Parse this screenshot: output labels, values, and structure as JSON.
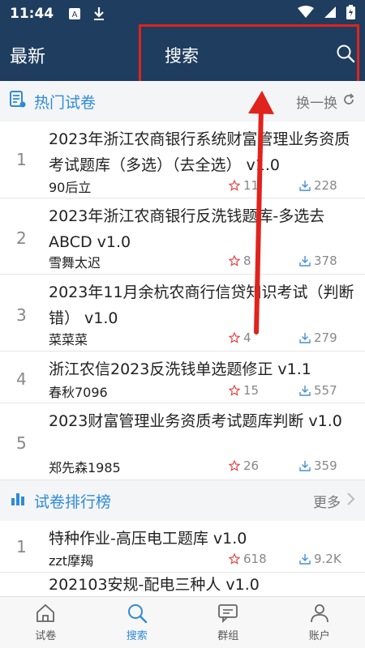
{
  "status": {
    "time": "11:44"
  },
  "header": {
    "left_title": "最新",
    "search_label": "搜索"
  },
  "hot": {
    "title": "热门试卷",
    "refresh_label": "换一换",
    "items": [
      {
        "index": "1",
        "title": "2023年浙江农商银行系统财富管理业务资质考试题库（多选）（去全选） v1.0",
        "author": "90后立",
        "stars": "11",
        "downloads": "228"
      },
      {
        "index": "2",
        "title": "2023年浙江农商银行反洗钱题库-多选去ABCD v1.0",
        "author": "雪舞太迟",
        "stars": "8",
        "downloads": "378"
      },
      {
        "index": "3",
        "title": "2023年11月余杭农商行信贷知识考试（判断错） v1.0",
        "author": "菜菜菜",
        "stars": "4",
        "downloads": "279"
      },
      {
        "index": "4",
        "title": "浙江农信2023反洗钱单选题修正 v1.1",
        "author": "春秋7096",
        "stars": "15",
        "downloads": "557"
      },
      {
        "index": "5",
        "title": "2023财富管理业务资质考试题库判断 v1.0",
        "author": "郑先森1985",
        "stars": "26",
        "downloads": "359"
      }
    ]
  },
  "ranking": {
    "title": "试卷排行榜",
    "more_label": "更多",
    "items": [
      {
        "index": "1",
        "title": "特种作业-高压电工题库 v1.0",
        "author": "zzt摩羯",
        "stars": "618",
        "downloads": "9.2K"
      },
      {
        "index": "2",
        "title": "202103安规-配电三种人 v1.0",
        "author": "",
        "stars": "",
        "downloads": ""
      }
    ]
  },
  "tabs": [
    {
      "label": "试卷",
      "icon": "house-icon"
    },
    {
      "label": "搜索",
      "icon": "search-icon"
    },
    {
      "label": "群组",
      "icon": "chat-icon"
    },
    {
      "label": "账户",
      "icon": "person-icon"
    }
  ],
  "colors": {
    "header_bg": "#1f3d5f",
    "accent": "#2f8ad8",
    "highlight": "#e0231c"
  }
}
